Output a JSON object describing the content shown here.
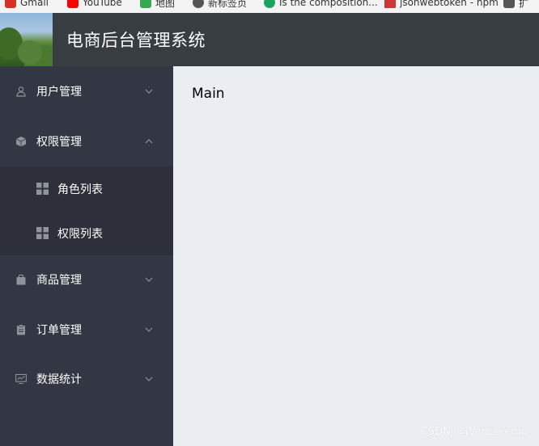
{
  "bookmarks": [
    {
      "label": "Gmail",
      "icon": "gmail-icon",
      "color": "#d93025"
    },
    {
      "label": "YouTube",
      "icon": "youtube-icon",
      "color": "#ff0000"
    },
    {
      "label": "地图",
      "icon": "maps-icon",
      "color": "#34a853"
    },
    {
      "label": "新标签页",
      "icon": "globe-icon",
      "color": "#555555"
    },
    {
      "label": "Is the composition...",
      "icon": "site-icon",
      "color": "#1aa260"
    },
    {
      "label": "jsonwebtoken - npm",
      "icon": "npm-icon",
      "color": "#cb3837"
    },
    {
      "label": "扩",
      "icon": "home-icon",
      "color": "#555555"
    }
  ],
  "header": {
    "title": "电商后台管理系统"
  },
  "sidebar": {
    "items": [
      {
        "label": "用户管理",
        "icon": "user-icon",
        "expanded": false
      },
      {
        "label": "权限管理",
        "icon": "box-icon",
        "expanded": true,
        "children": [
          {
            "label": "角色列表",
            "icon": "grid-icon"
          },
          {
            "label": "权限列表",
            "icon": "grid-icon"
          }
        ]
      },
      {
        "label": "商品管理",
        "icon": "bag-icon",
        "expanded": false
      },
      {
        "label": "订单管理",
        "icon": "clipboard-icon",
        "expanded": false
      },
      {
        "label": "数据统计",
        "icon": "chart-icon",
        "expanded": false
      }
    ]
  },
  "main": {
    "content": "Main"
  },
  "watermark": "CSDN @¡Venceremo",
  "colors": {
    "header_bg": "#373d41",
    "sidebar_bg": "#333744",
    "submenu_bg": "#2d303b",
    "main_bg": "#eaedf1",
    "icon_gray": "#909399"
  }
}
